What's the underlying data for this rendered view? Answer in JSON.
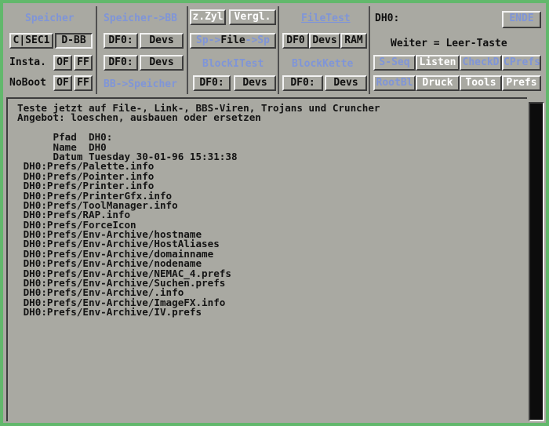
{
  "speicher_panel": {
    "title": "Speicher",
    "sec_button": "C|SEC1",
    "dbb_button": "D-BB",
    "insta_label": "Insta.",
    "insta_of": "OF",
    "insta_ff": "FF",
    "noboot_label": "NoBoot",
    "noboot_of": "OF",
    "noboot_ff": "FF"
  },
  "speicher_bb_panel": {
    "title": "Speicher->BB",
    "df0_1": "DF0:",
    "devs_1": "Devs",
    "df0_2": "DF0:",
    "devs_2": "Devs",
    "bb_speicher": "BB->Speicher"
  },
  "zyl_panel": {
    "zzyl": "z.Zyl",
    "vergl": "Vergl.",
    "sp_file_left": "Sp->",
    "sp_file_mid": "File",
    "sp_file_right": "->Sp",
    "blocktest": "BlockITest",
    "df0": "DF0:",
    "devs": "Devs"
  },
  "filetest_panel": {
    "title": "FileTest",
    "df0": "DF0",
    "devs": "Devs",
    "ram": "RAM",
    "blockkette": "BlockKette",
    "df0_b": "DF0:",
    "devs_b": "Devs"
  },
  "right_panel": {
    "device": "DH0:",
    "ende": "ENDE",
    "hint": "Weiter = Leer-Taste",
    "buttons_row1": [
      "S-Seq",
      "Listen",
      "CheckD",
      "CPrefs"
    ],
    "buttons_row2": [
      "RootBl",
      "Druck",
      "Tools",
      "Prefs"
    ]
  },
  "console": {
    "lines": [
      "Teste jetzt auf File-, Link-, BBS-Viren, Trojans und Cruncher",
      "Angebot: loeschen, ausbauen oder ersetzen",
      "",
      "      Pfad  DH0:",
      "      Name  DH0",
      "      Datum Tuesday 30-01-96 15:31:38",
      " DH0:Prefs/Palette.info",
      " DH0:Prefs/Pointer.info",
      " DH0:Prefs/Printer.info",
      " DH0:Prefs/PrinterGfx.info",
      " DH0:Prefs/ToolManager.info",
      " DH0:Prefs/RAP.info",
      " DH0:Prefs/ForceIcon",
      " DH0:Prefs/Env-Archive/hostname",
      " DH0:Prefs/Env-Archive/HostAliases",
      " DH0:Prefs/Env-Archive/domainname",
      " DH0:Prefs/Env-Archive/nodename",
      " DH0:Prefs/Env-Archive/NEMAC_4.prefs",
      " DH0:Prefs/Env-Archive/Suchen.prefs",
      " DH0:Prefs/Env-Archive/.info",
      " DH0:Prefs/Env-Archive/ImageFX.info",
      " DH0:Prefs/Env-Archive/IV.prefs"
    ]
  },
  "colors": {
    "background": "#62b86c",
    "panel": "#a9a9a2",
    "disabled_text": "#7f95d8",
    "text": "#101010"
  }
}
